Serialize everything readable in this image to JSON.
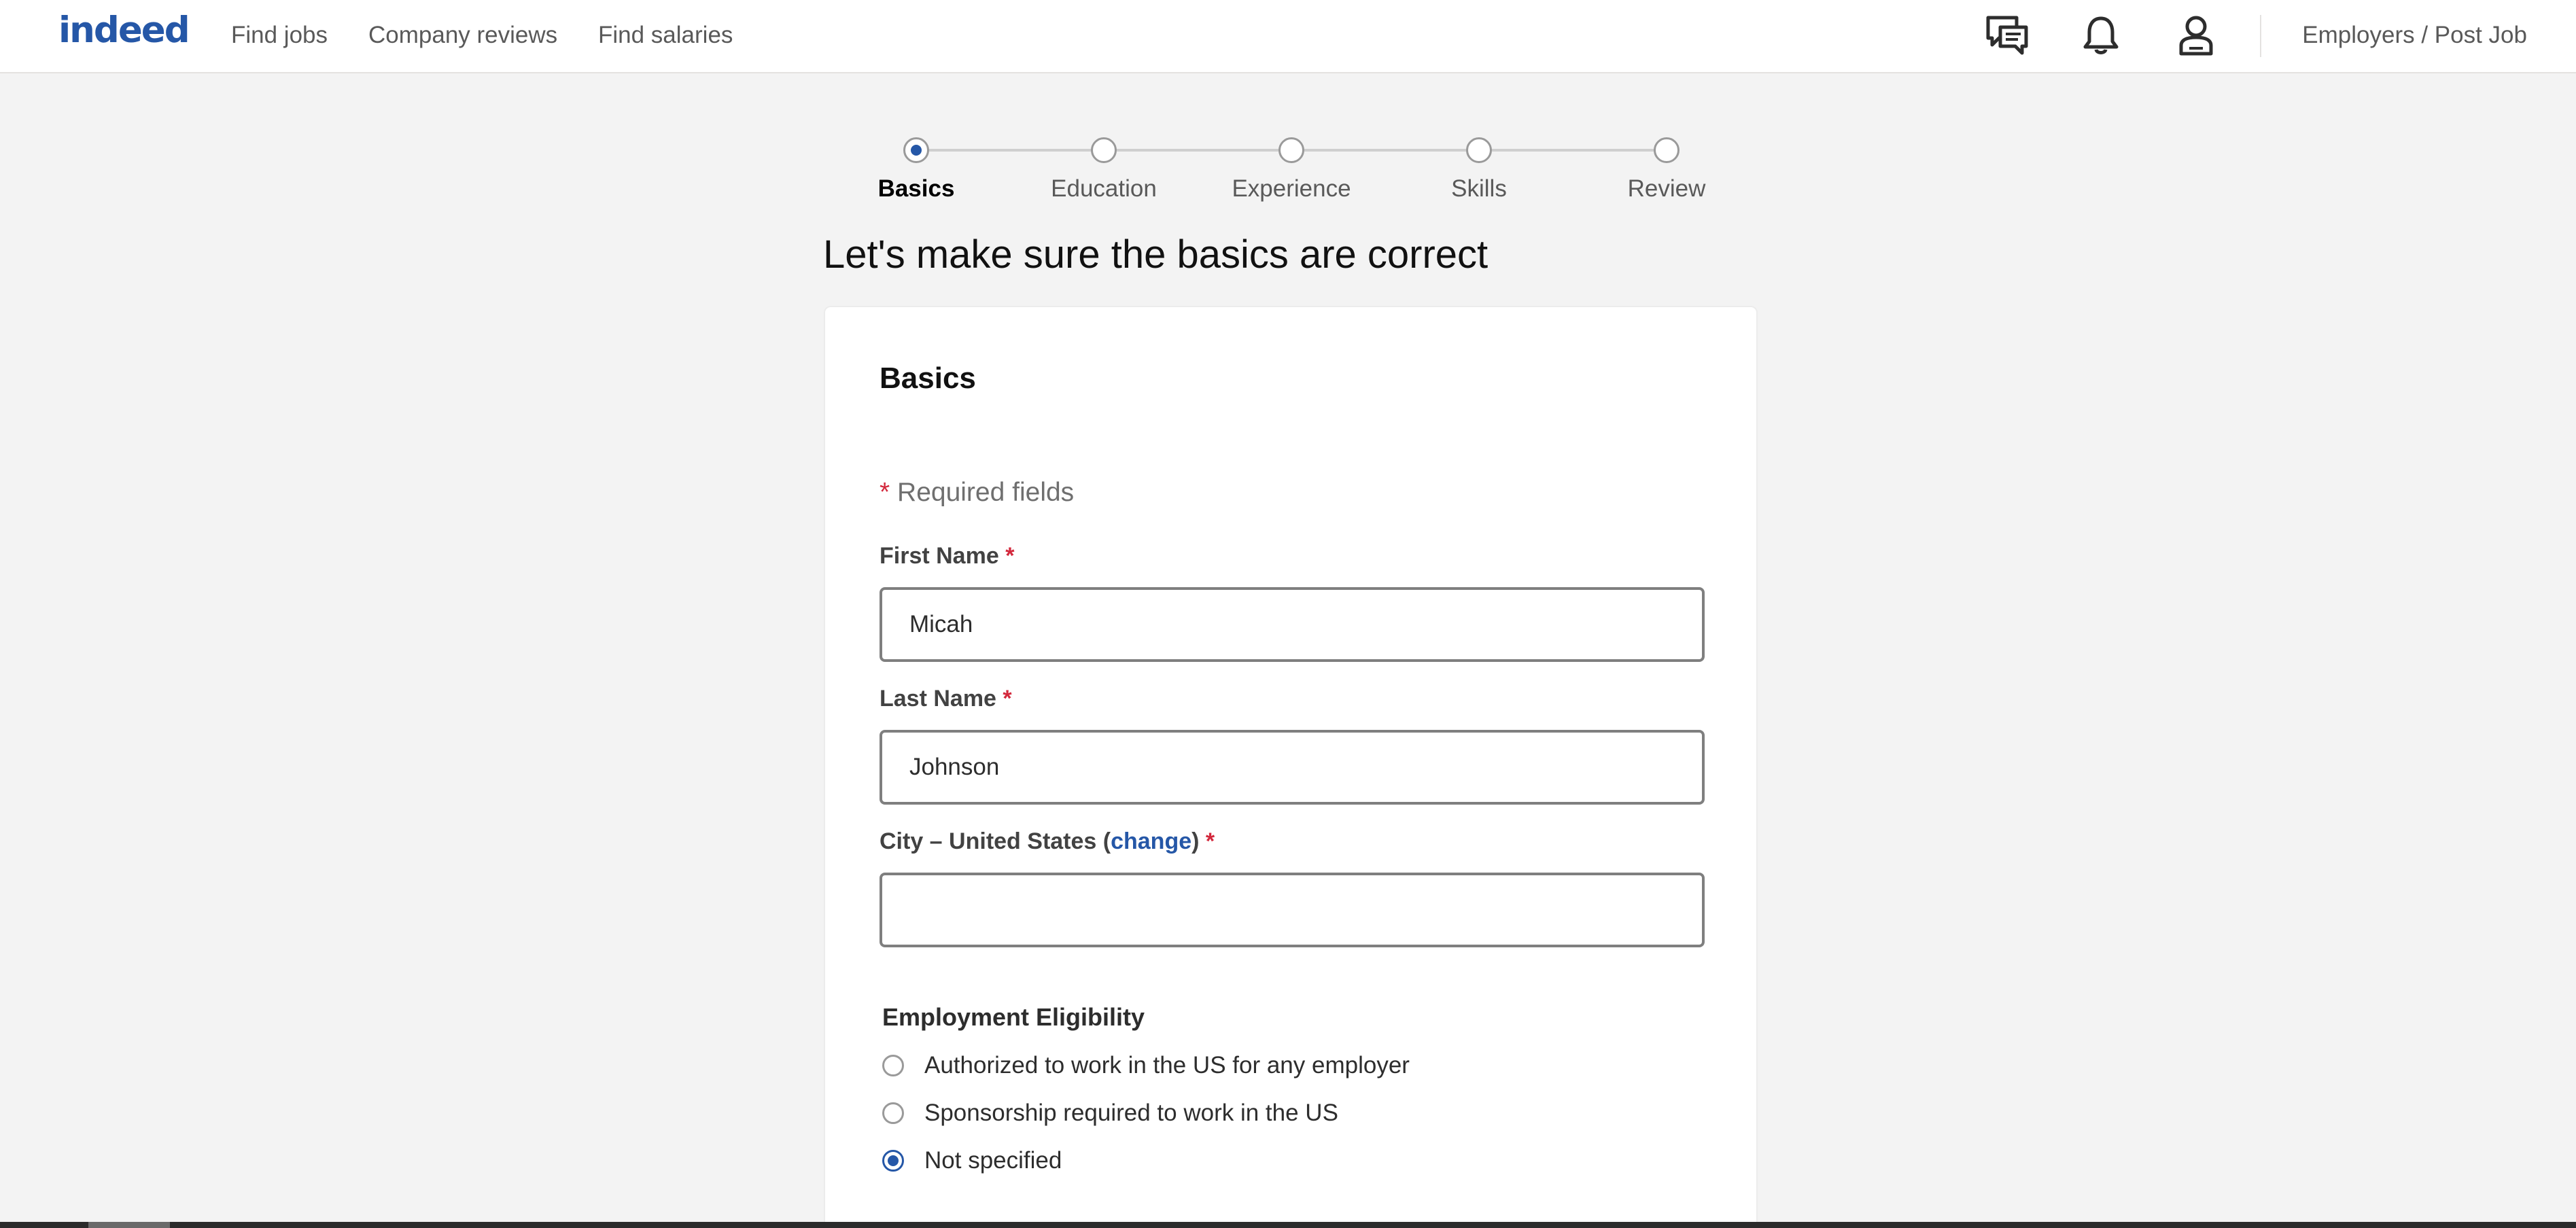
{
  "header": {
    "logo": "indeed",
    "nav": [
      "Find jobs",
      "Company reviews",
      "Find salaries"
    ],
    "icons": [
      "messages-icon",
      "notifications-bell-icon",
      "profile-icon"
    ],
    "employers_link": "Employers / Post Job"
  },
  "stepper": {
    "steps": [
      "Basics",
      "Education",
      "Experience",
      "Skills",
      "Review"
    ],
    "active_step": "Basics"
  },
  "page_title": "Let's make sure the basics are correct",
  "card": {
    "title": "Basics",
    "required_asterisk": "*",
    "required_note": "Required fields",
    "first_name": {
      "label": "First Name",
      "value": "Micah"
    },
    "last_name": {
      "label": "Last Name",
      "value": "Johnson"
    },
    "city": {
      "label_prefix": "City –",
      "label_country": "United States",
      "change_link": "change",
      "value": ""
    },
    "eligibility": {
      "label": "Employment Eligibility",
      "options": [
        "Authorized to work in the US for any employer",
        "Sponsorship required to work in the US",
        "Not specified"
      ],
      "selected": "Not specified"
    }
  },
  "colors": {
    "brand_blue": "#2557a7",
    "required_red": "#d3283c",
    "page_background": "#f3f3f3"
  }
}
